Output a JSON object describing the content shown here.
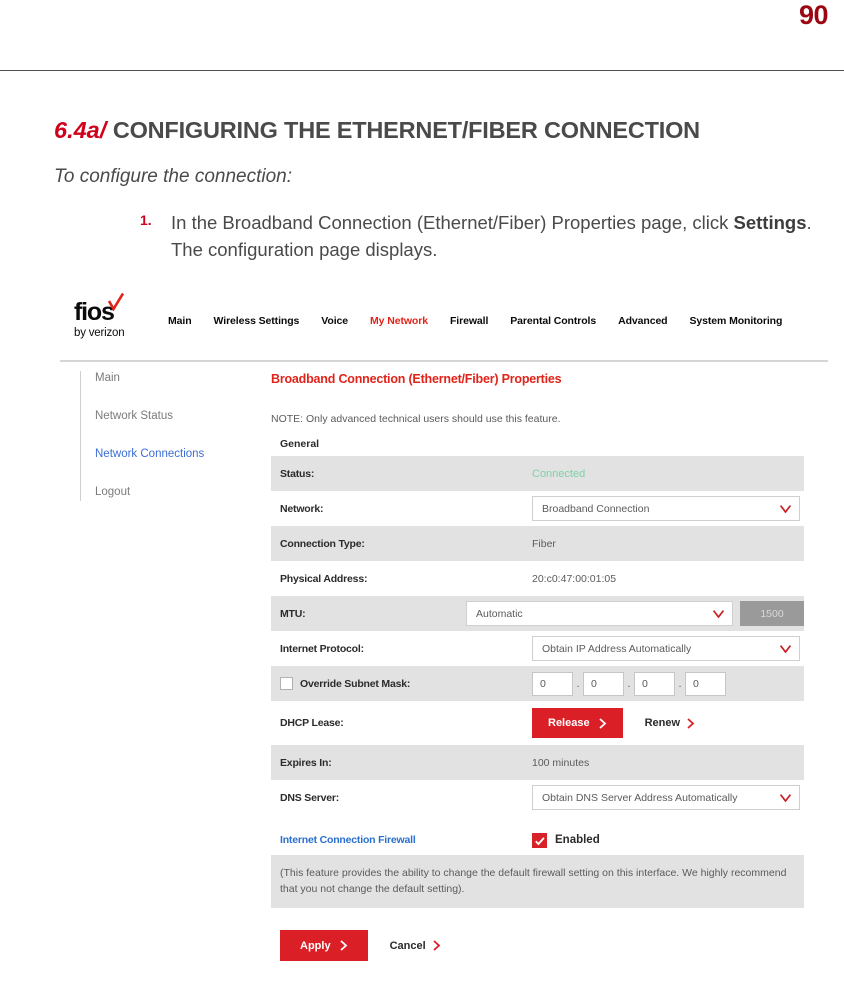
{
  "page": {
    "number": "90"
  },
  "section": {
    "number": "6.4a/",
    "title": "CONFIGURING THE ETHERNET/FIBER CONNECTION",
    "subhead": "To configure the connection:"
  },
  "step": {
    "marker": "1.",
    "text_before": "In the Broadband Connection (Ethernet/Fiber) Properties page, click ",
    "bold": "Settings",
    "text_after": ". The configuration page displays."
  },
  "router_ui": {
    "logo": {
      "wordmark": "fios",
      "tagline": "by verizon"
    },
    "nav": [
      {
        "label": "Main",
        "active": false
      },
      {
        "label": "Wireless Settings",
        "active": false
      },
      {
        "label": "Voice",
        "active": false
      },
      {
        "label": "My Network",
        "active": true
      },
      {
        "label": "Firewall",
        "active": false
      },
      {
        "label": "Parental Controls",
        "active": false
      },
      {
        "label": "Advanced",
        "active": false
      },
      {
        "label": "System Monitoring",
        "active": false
      }
    ],
    "sidebar": [
      {
        "label": "Main",
        "active": false
      },
      {
        "label": "Network Status",
        "active": false
      },
      {
        "label": "Network Connections",
        "active": true
      },
      {
        "label": "Logout",
        "active": false
      }
    ],
    "panel": {
      "title": "Broadband Connection (Ethernet/Fiber) Properties",
      "note": "NOTE: Only advanced technical users should use this feature.",
      "group_label": "General"
    },
    "rows": {
      "status_label": "Status:",
      "status_value": "Connected",
      "network_label": "Network:",
      "network_value": "Broadband Connection",
      "connection_type_label": "Connection Type:",
      "connection_type_value": "Fiber",
      "physical_address_label": "Physical Address:",
      "physical_address_value": "20:c0:47:00:01:05",
      "mtu_label": "MTU:",
      "mtu_value": "Automatic",
      "mtu_size": "1500",
      "internet_protocol_label": "Internet Protocol:",
      "internet_protocol_value": "Obtain IP Address Automatically",
      "override_subnet_label": "Override Subnet Mask:",
      "subnet_octets": [
        "0",
        "0",
        "0",
        "0"
      ],
      "dhcp_lease_label": "DHCP Lease:",
      "release_label": "Release",
      "renew_label": "Renew",
      "expires_in_label": "Expires In:",
      "expires_in_value": "100 minutes",
      "dns_server_label": "DNS Server:",
      "dns_server_value": "Obtain DNS Server Address Automatically"
    },
    "firewall": {
      "title": "Internet Connection Firewall",
      "enabled_label": "Enabled",
      "note": "(This feature provides the ability to change the default firewall setting on this interface. We highly recommend that you not change the default setting)."
    },
    "actions": {
      "apply_label": "Apply",
      "cancel_label": "Cancel"
    },
    "colors": {
      "brand_red": "#e2231a",
      "link_blue": "#3b6fd4",
      "status_green": "#7fd0a8",
      "row_shade": "#e2e2e2"
    }
  }
}
